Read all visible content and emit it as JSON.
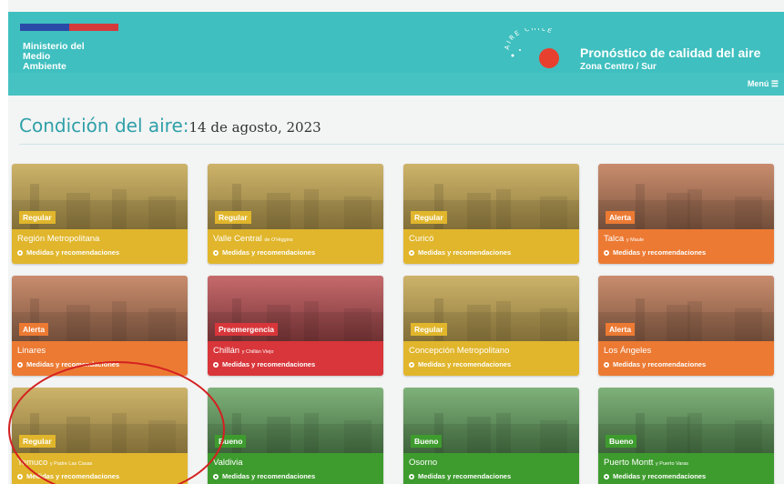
{
  "header": {
    "ministry_line1": "Ministerio del",
    "ministry_line2": "Medio",
    "ministry_line3": "Ambiente",
    "logo_text": "AIRE CHILE",
    "site_title": "Pronóstico de calidad del aire",
    "site_subtitle": "Zona Centro / Sur",
    "flag_colors": [
      "#2a4aa8",
      "#d43a3a"
    ]
  },
  "menu": {
    "label": "Menú ☰"
  },
  "condition": {
    "heading": "Condición del aire:",
    "date": "14 de agosto, 2023"
  },
  "card_common": {
    "medidas_label": "Medidas y recomendaciones"
  },
  "status_colors": {
    "Regular": "#e1b62c",
    "Alerta": "#ec7a33",
    "Preemergencia": "#d8363a",
    "Bueno": "#3e9c2e"
  },
  "cards": [
    {
      "status": "Regular",
      "region": "Región Metropolitana",
      "suffix": ""
    },
    {
      "status": "Regular",
      "region": "Valle Central",
      "suffix": "de O'Higgins"
    },
    {
      "status": "Regular",
      "region": "Curicó",
      "suffix": ""
    },
    {
      "status": "Alerta",
      "region": "Talca",
      "suffix": "y Maule"
    },
    {
      "status": "Alerta",
      "region": "Linares",
      "suffix": ""
    },
    {
      "status": "Preemergencia",
      "region": "Chillán",
      "suffix": "y Chillán Viejo"
    },
    {
      "status": "Regular",
      "region": "Concepción Metropolitano",
      "suffix": ""
    },
    {
      "status": "Alerta",
      "region": "Los Ángeles",
      "suffix": ""
    },
    {
      "status": "Regular",
      "region": "Temuco",
      "suffix": "y Padre Las Casas"
    },
    {
      "status": "Bueno",
      "region": "Valdivia",
      "suffix": ""
    },
    {
      "status": "Bueno",
      "region": "Osorno",
      "suffix": ""
    },
    {
      "status": "Bueno",
      "region": "Puerto Montt",
      "suffix": "y Puerto Varas"
    }
  ]
}
